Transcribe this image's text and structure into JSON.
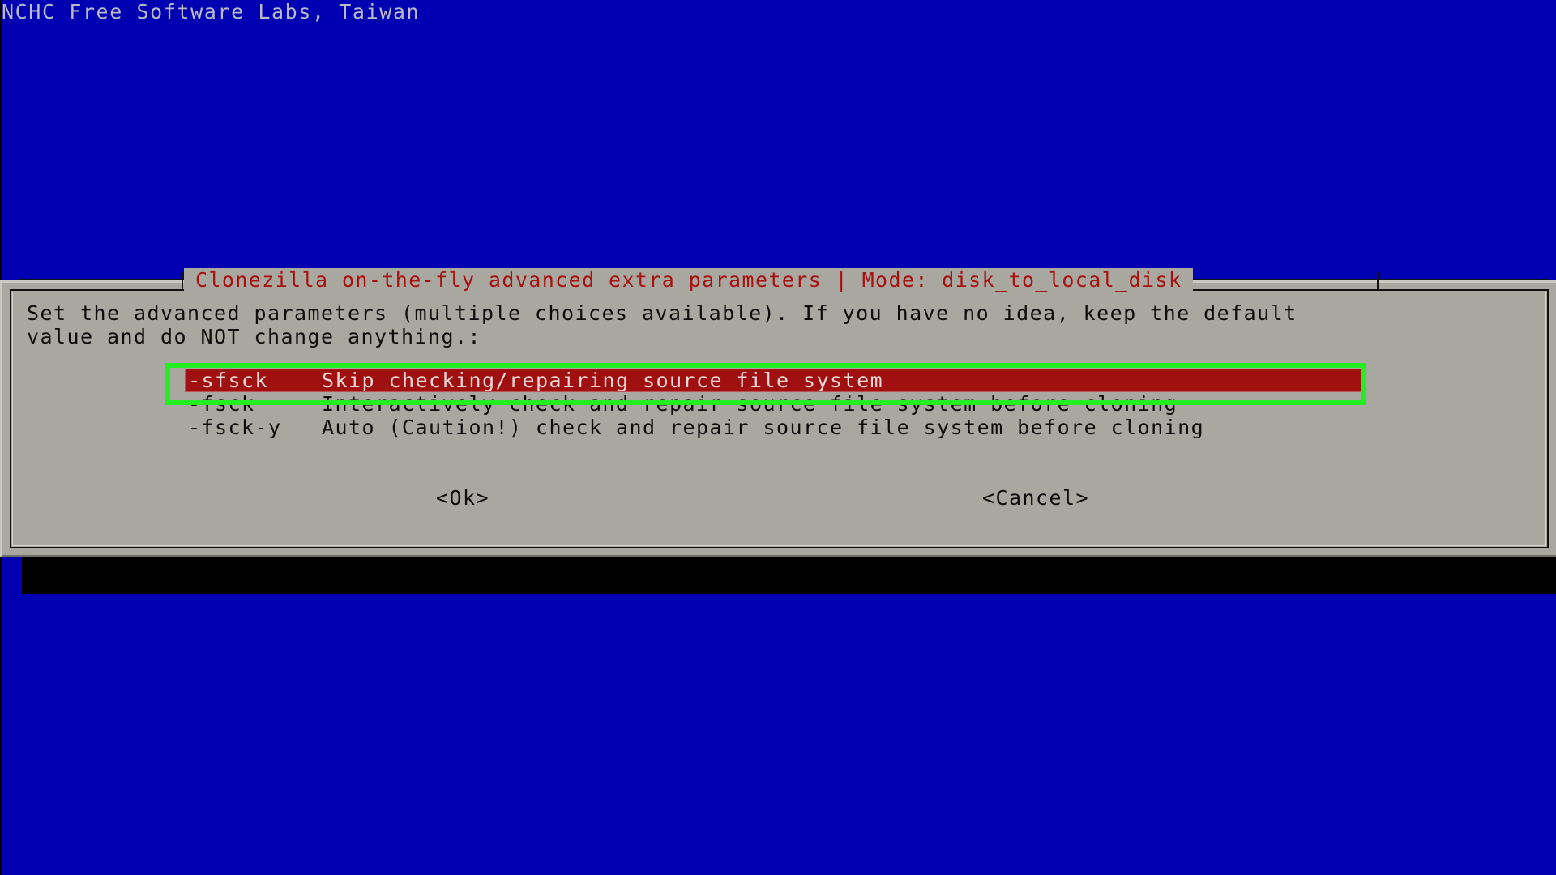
{
  "screen": {
    "background_color": "#0000b2",
    "banner": "NCHC Free Software Labs, Taiwan"
  },
  "dialog": {
    "title": "Clonezilla on-the-fly advanced extra parameters | Mode: disk_to_local_disk",
    "title_color": "#a81010",
    "background_color": "#a8a8a0",
    "prompt_line_1": "Set the advanced parameters (multiple choices available). If you have no idea, keep the default",
    "prompt_line_2": "value and do NOT change anything.:",
    "options": [
      {
        "flag": "-sfsck",
        "description": "Skip checking/repairing source file system",
        "text": "-sfsck    Skip checking/repairing source file system",
        "selected": true
      },
      {
        "flag": "-fsck",
        "description": "Interactively check and repair source file system before cloning",
        "text": "-fsck     Interactively check and repair source file system before cloning",
        "selected": false
      },
      {
        "flag": "-fsck-y",
        "description": "Auto (Caution!) check and repair source file system before cloning",
        "text": "-fsck-y   Auto (Caution!) check and repair source file system before cloning",
        "selected": false
      }
    ],
    "selection_highlight_color": "#a01010",
    "annotation_box_color": "#22ee22",
    "buttons": {
      "ok": "<Ok>",
      "cancel": "<Cancel>"
    }
  }
}
